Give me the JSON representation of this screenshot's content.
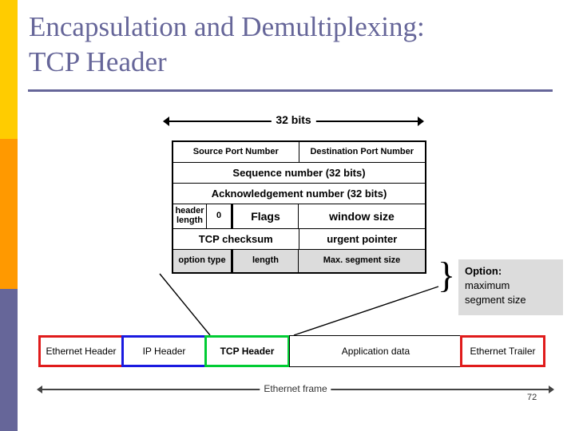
{
  "slide": {
    "title": "Encapsulation and Demultiplexing:\nTCP Header",
    "page_number": "72",
    "accent_colors": {
      "title": "#666699",
      "band_top": "#ffcc00",
      "band_middle": "#ff9900",
      "band_bottom": "#666699",
      "red_border": "#e01b1b",
      "blue_border": "#1a1ae0",
      "green_border": "#00cc33",
      "gray_fill": "#dcdcdc"
    }
  },
  "tcp_header_diagram": {
    "width_label": "32 bits",
    "rows": [
      {
        "cells": [
          {
            "text": "Source Port Number"
          },
          {
            "text": "Destination Port Number"
          }
        ]
      },
      {
        "cells": [
          {
            "text": "Sequence number (32 bits)"
          }
        ]
      },
      {
        "cells": [
          {
            "text": "Acknowledgement number (32 bits)"
          }
        ]
      },
      {
        "cells": [
          {
            "text": "header length"
          },
          {
            "text": "0"
          },
          {
            "text": "Flags"
          },
          {
            "text": "window size"
          }
        ]
      },
      {
        "cells": [
          {
            "text": "TCP checksum"
          },
          {
            "text": "urgent pointer"
          }
        ]
      },
      {
        "cells": [
          {
            "text": "option type"
          },
          {
            "text": "length"
          },
          {
            "text": "Max. segment size"
          }
        ]
      }
    ]
  },
  "option_callout": {
    "heading": "Option:",
    "line2": "maximum",
    "line3": "segment size",
    "brace": "}"
  },
  "ethernet_frame": {
    "measure_label": "Ethernet frame",
    "boxes": [
      {
        "label": "Ethernet Header",
        "border_color": "#e01b1b"
      },
      {
        "label": "IP Header",
        "border_color": "#1a1ae0"
      },
      {
        "label": "TCP Header",
        "border_color": "#00cc33"
      },
      {
        "label": "Application data",
        "border_color": "#000000"
      },
      {
        "label": "Ethernet Trailer",
        "border_color": "#e01b1b"
      }
    ]
  }
}
